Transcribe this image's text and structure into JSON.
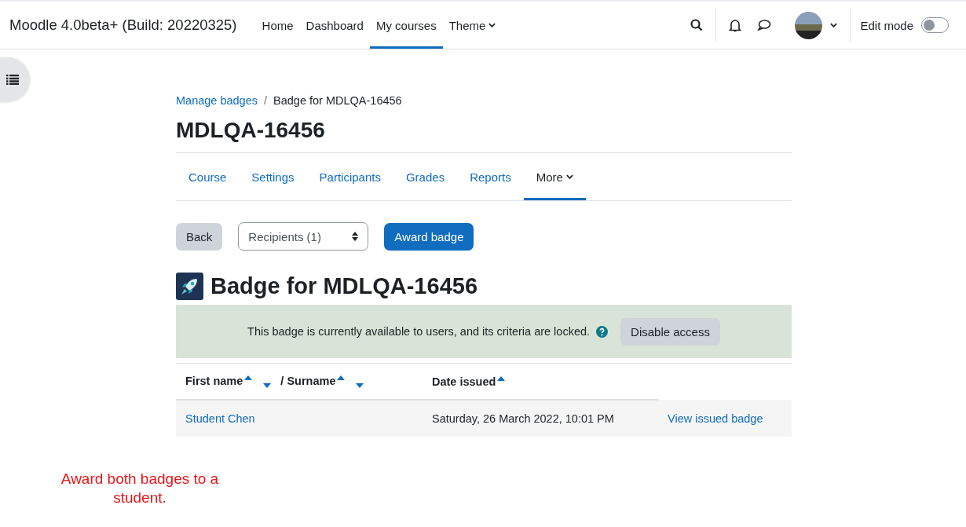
{
  "navbar": {
    "site_name": "Moodle 4.0beta+ (Build: 20220325)",
    "items": [
      {
        "label": "Home",
        "selected": false,
        "kind": "link"
      },
      {
        "label": "Dashboard",
        "selected": false,
        "kind": "link"
      },
      {
        "label": "My courses",
        "selected": true,
        "kind": "link"
      },
      {
        "label": "Theme",
        "selected": false,
        "kind": "dropdown"
      }
    ],
    "edit_mode": {
      "label": "Edit mode",
      "on": false
    }
  },
  "breadcrumb": {
    "separator": "/",
    "items": [
      {
        "label": "Manage badges",
        "kind": "link"
      },
      {
        "label": "Badge for MDLQA-16456",
        "kind": "current"
      }
    ]
  },
  "page_title": "MDLQA-16456",
  "secondary_nav": [
    {
      "label": "Course",
      "selected": false,
      "kind": "link"
    },
    {
      "label": "Settings",
      "selected": false,
      "kind": "link"
    },
    {
      "label": "Participants",
      "selected": false,
      "kind": "link"
    },
    {
      "label": "Grades",
      "selected": false,
      "kind": "link"
    },
    {
      "label": "Reports",
      "selected": false,
      "kind": "link"
    },
    {
      "label": "More",
      "selected": true,
      "kind": "dropdown"
    }
  ],
  "actions": {
    "back": "Back",
    "recipients_select": "Recipients (1)",
    "award": "Award badge"
  },
  "badge_heading": "Badge for MDLQA-16456",
  "alert": {
    "message": "This badge is currently available to users, and its criteria are locked.",
    "button": "Disable access"
  },
  "table": {
    "columns": [
      {
        "label": "First name",
        "sorted": true,
        "collapsible": true
      },
      {
        "label": "/ Surname",
        "sorted": true,
        "collapsible": true
      },
      {
        "label": "Date issued",
        "sorted": true,
        "collapsible": false
      }
    ],
    "rows": [
      {
        "name": "Student Chen",
        "date_issued": "Saturday, 26 March 2022, 10:01 PM",
        "action": "View issued badge"
      }
    ]
  },
  "annotation": "Award both badges to a student."
}
